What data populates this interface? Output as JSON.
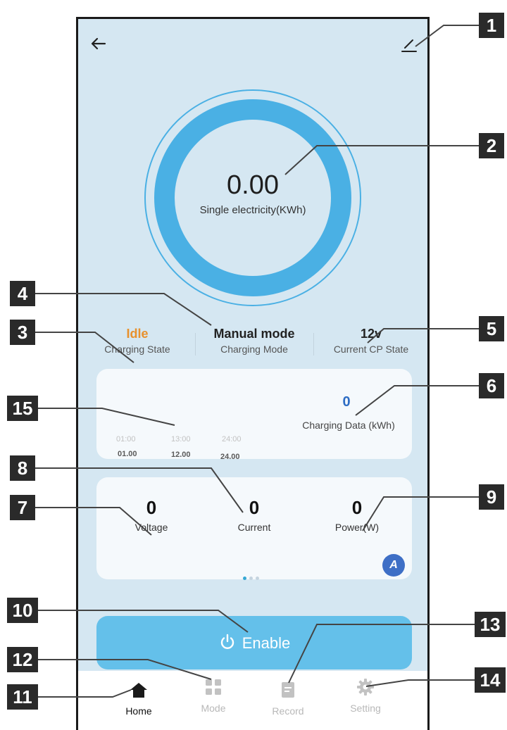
{
  "main": {
    "electricity_value": "0.00",
    "electricity_label": "Single electricity(KWh)"
  },
  "status": {
    "charging_state_value": "Idle",
    "charging_state_label": "Charging State",
    "charging_mode_value": "Manual mode",
    "charging_mode_label": "Charging Mode",
    "cp_state_value": "12v",
    "cp_state_label": "Current CP State"
  },
  "charging_data": {
    "times_top": [
      "01:00",
      "13:00",
      "24:00"
    ],
    "times_bottom": [
      "01.00",
      "12.00",
      "24.00"
    ],
    "value": "0",
    "label": "Charging Data (kWh)"
  },
  "measurements": {
    "voltage_value": "0",
    "voltage_label": "Voltage",
    "current_value": "0",
    "current_label": "Current",
    "power_value": "0",
    "power_label": "Power(W)",
    "auto_badge": "A"
  },
  "enable_button": {
    "label": "Enable"
  },
  "tabbar": {
    "home": "Home",
    "mode": "Mode",
    "record": "Record",
    "setting": "Setting"
  },
  "callouts": [
    "1",
    "2",
    "3",
    "4",
    "5",
    "6",
    "7",
    "8",
    "9",
    "10",
    "11",
    "12",
    "13",
    "14",
    "15"
  ],
  "colors": {
    "background": "#d5e7f2",
    "ring": "#4ab0e4",
    "idle": "#e8912d",
    "accent_blue": "#2e6dc4",
    "enable_button": "#64c0ea"
  },
  "icons": {
    "back": "back-arrow-icon",
    "edit": "edit-pencil-icon",
    "power": "power-icon",
    "home": "home-icon",
    "mode": "grid-icon",
    "record": "document-icon",
    "setting": "gear-icon"
  }
}
